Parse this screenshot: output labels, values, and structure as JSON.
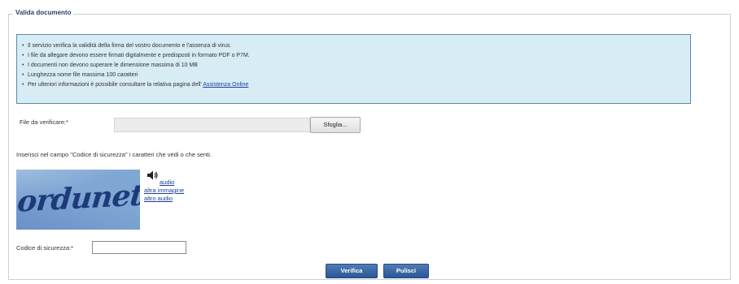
{
  "form": {
    "legend": "Valida documento"
  },
  "info": {
    "items": [
      "Il servizio verifica la validità della firma del vostro documento e l'assenza di virus.",
      "I file da allegare devono essere firmati digitalmente e predisposti in formato PDF o P7M.",
      "I documenti non devono superare le dimensione massima di 10 MB",
      "Lunghezza nome file massima 100 caratteri"
    ],
    "last_item_prefix": "Per ulteriori informazioni è possibile consultare la relativa pagina dell' ",
    "last_item_link": "Assistenza Online"
  },
  "file": {
    "label": "File da verificare:*",
    "browse_label": "Sfoglia..."
  },
  "captcha": {
    "instructions": "Inserisci nel campo \"Codice di sicurezza\" i caratteri che vedi o che senti.",
    "image_text": "orduneto",
    "audio_link": "audio",
    "other_image_link": "altra immagine",
    "other_audio_link": "altro audio",
    "code_label": "Codice di sicurezza:*",
    "code_value": ""
  },
  "actions": {
    "verify_label": "Verifica",
    "clear_label": "Pulisci"
  },
  "icons": {
    "speaker": "speaker-icon"
  },
  "colors": {
    "info_background": "#d7ecf4",
    "info_border": "#5d8aa8",
    "link": "#1c3f9c",
    "button": "#2b5796",
    "legend": "#2b3f64"
  }
}
